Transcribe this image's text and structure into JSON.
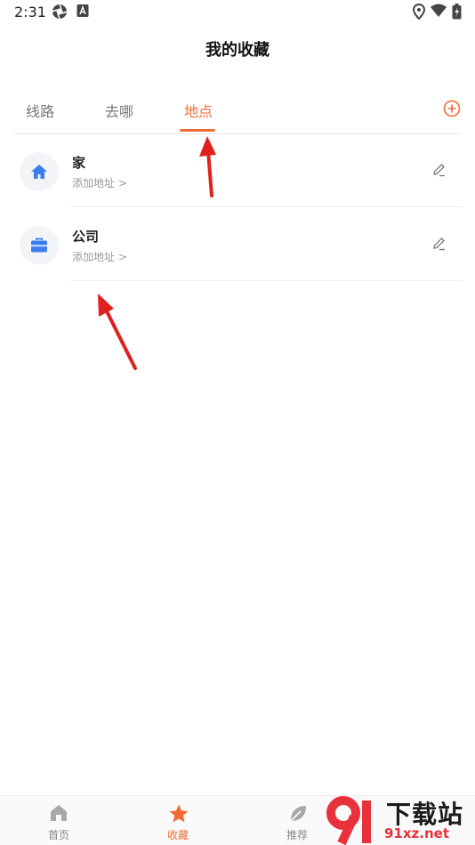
{
  "status_bar": {
    "time": "2:31"
  },
  "header": {
    "title": "我的收藏"
  },
  "tabs": [
    {
      "label": "线路",
      "active": false
    },
    {
      "label": "去哪",
      "active": false
    },
    {
      "label": "地点",
      "active": true
    }
  ],
  "places": [
    {
      "name": "家",
      "sub": "添加地址 >",
      "icon": "home-icon"
    },
    {
      "name": "公司",
      "sub": "添加地址 >",
      "icon": "briefcase-icon"
    }
  ],
  "bottom_nav": [
    {
      "label": "首页",
      "icon": "home-icon",
      "active": false
    },
    {
      "label": "收藏",
      "icon": "star-icon",
      "active": true
    },
    {
      "label": "推荐",
      "icon": "leaf-icon",
      "active": false
    }
  ],
  "watermark": {
    "text_cn": "下载站",
    "url": "91xz.net",
    "logo": "91"
  },
  "colors": {
    "accent": "#f36b34",
    "icon_blue": "#3b7ded",
    "arrow_red": "#e0201f"
  }
}
